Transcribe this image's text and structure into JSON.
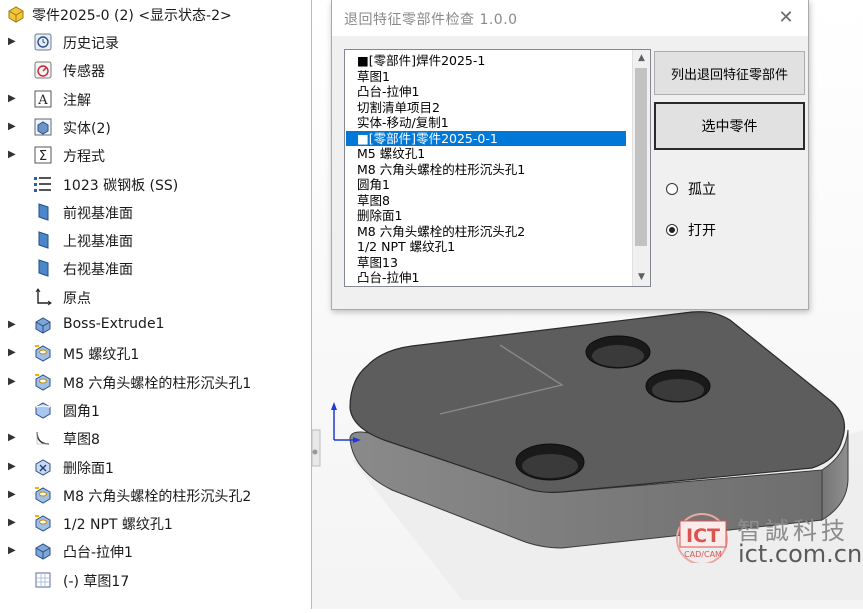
{
  "tree": {
    "root": "零件2025-0 (2) <显示状态-2>",
    "items": [
      {
        "label": "历史记录",
        "icon": "history-icon",
        "expandable": true
      },
      {
        "label": "传感器",
        "icon": "sensor-icon",
        "expandable": false
      },
      {
        "label": "注解",
        "icon": "annotation-icon",
        "expandable": true
      },
      {
        "label": "实体(2)",
        "icon": "solid-bodies-icon",
        "expandable": true
      },
      {
        "label": "方程式",
        "icon": "equations-icon",
        "expandable": true
      },
      {
        "label": "1023 碳钢板 (SS)",
        "icon": "material-icon",
        "expandable": false
      },
      {
        "label": "前视基准面",
        "icon": "plane-icon",
        "expandable": false
      },
      {
        "label": "上视基准面",
        "icon": "plane-icon",
        "expandable": false
      },
      {
        "label": "右视基准面",
        "icon": "plane-icon",
        "expandable": false
      },
      {
        "label": "原点",
        "icon": "origin-icon",
        "expandable": false
      },
      {
        "label": "Boss-Extrude1",
        "icon": "extrude-icon",
        "expandable": true
      },
      {
        "label": "M5 螺纹孔1",
        "icon": "hole-icon",
        "expandable": true
      },
      {
        "label": "M8 六角头螺栓的柱形沉头孔1",
        "icon": "hole-icon",
        "expandable": true
      },
      {
        "label": "圆角1",
        "icon": "fillet-icon",
        "expandable": false
      },
      {
        "label": "草图8",
        "icon": "sketch-icon",
        "expandable": true
      },
      {
        "label": "删除面1",
        "icon": "delete-face-icon",
        "expandable": true
      },
      {
        "label": "M8 六角头螺栓的柱形沉头孔2",
        "icon": "hole-icon",
        "expandable": true
      },
      {
        "label": "1/2 NPT 螺纹孔1",
        "icon": "hole-icon",
        "expandable": true
      },
      {
        "label": "凸台-拉伸1",
        "icon": "extrude-icon",
        "expandable": true
      },
      {
        "label": "(-) 草图17",
        "icon": "sketch-grid-icon",
        "expandable": false
      }
    ]
  },
  "dialog": {
    "title": "退回特征零部件检查 1.0.0",
    "close_icon": "close-icon",
    "list": [
      "■[零部件]焊件2025-1",
      "草图1",
      "凸台-拉伸1",
      "切割清单项目2",
      "实体-移动/复制1",
      "■[零部件]零件2025-0-1",
      "M5 螺纹孔1",
      "M8 六角头螺栓的柱形沉头孔1",
      "圆角1",
      "草图8",
      "删除面1",
      "M8 六角头螺栓的柱形沉头孔2",
      "1/2 NPT 螺纹孔1",
      "草图13",
      "凸台-拉伸1"
    ],
    "selected_index": 5,
    "buttons": {
      "list_label": "列出退回特征零部件",
      "select_label": "选中零件"
    },
    "radios": {
      "isolate_label": "孤立",
      "open_label": "打开",
      "selected": "打开"
    }
  },
  "watermark": {
    "logo_text": "ICT",
    "logo_sub": "CAD/CAM",
    "company": "智誠科技",
    "url": "ict.com.cn"
  },
  "colors": {
    "selection": "#0078d7",
    "model_top": "#5d5d5d",
    "watermark_red": "#d9534f"
  }
}
